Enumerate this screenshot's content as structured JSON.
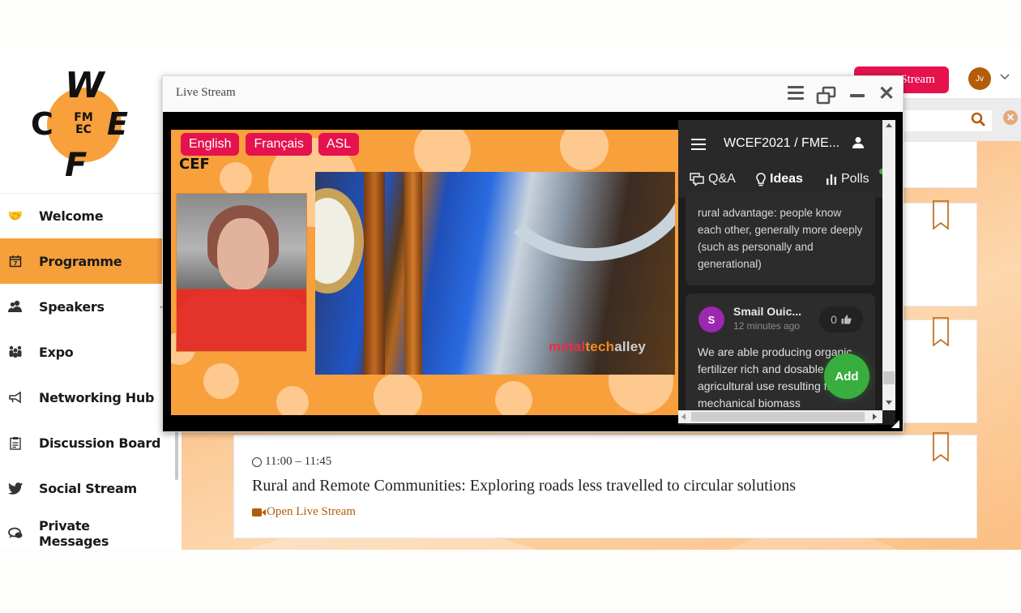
{
  "app": {
    "logo": {
      "letters": [
        "W",
        "C",
        "E",
        "F"
      ],
      "center_lines": [
        "FM",
        "EC"
      ],
      "brand_color": "#f7a03c"
    }
  },
  "sidebar": {
    "items": [
      {
        "label": "Welcome",
        "icon": "handshake-icon",
        "active": false
      },
      {
        "label": "Programme",
        "icon": "calendar-icon",
        "active": true
      },
      {
        "label": "Speakers",
        "icon": "users-icon",
        "active": false,
        "has_submenu": true
      },
      {
        "label": "Expo",
        "icon": "group-icon",
        "active": false
      },
      {
        "label": "Networking Hub",
        "icon": "megaphone-icon",
        "active": false
      },
      {
        "label": "Discussion Board",
        "icon": "clipboard-icon",
        "active": false
      },
      {
        "label": "Social Stream",
        "icon": "twitter-icon",
        "active": false
      },
      {
        "label": "Private Messages",
        "icon": "chat-icon",
        "active": false
      }
    ],
    "active_color": "#f6a03c"
  },
  "header": {
    "stream_button_label": "Stream",
    "stream_button_color": "#e5124e",
    "avatar_initials": "Jv",
    "avatar_color": "#b35c09"
  },
  "search": {
    "value": "",
    "placeholder": ""
  },
  "session": {
    "time": "11:00 – 11:45",
    "title": "Rural and Remote Communities: Exploring roads less travelled to circular solutions",
    "link_label": "Open Live Stream",
    "link_color": "#b35c09"
  },
  "live_stream": {
    "window_title": "Live Stream",
    "languages": [
      "English",
      "Français",
      "ASL"
    ],
    "video_brand": {
      "part1": "metal",
      "part2": "tech",
      "part3": "alley"
    },
    "video_logo": "CEF"
  },
  "chat": {
    "title": "WCEF2021 / FME...",
    "tabs": [
      {
        "label": "Q&A",
        "icon": "qa-icon",
        "active": false
      },
      {
        "label": "Ideas",
        "icon": "lightbulb-icon",
        "active": true
      },
      {
        "label": "Polls",
        "icon": "bar-chart-icon",
        "active": false
      }
    ],
    "ideas": [
      {
        "text": "rural advantage: people know each other, generally more deeply (such as personally and generational)"
      },
      {
        "author_initial": "S",
        "author": "Smail Ouic...",
        "time": "12 minutes ago",
        "votes": "0",
        "text": "We are able producing organic fertilizer rich and dosable for agricultural use resulting from a mechanical biomass"
      }
    ],
    "add_button_label": "Add"
  }
}
